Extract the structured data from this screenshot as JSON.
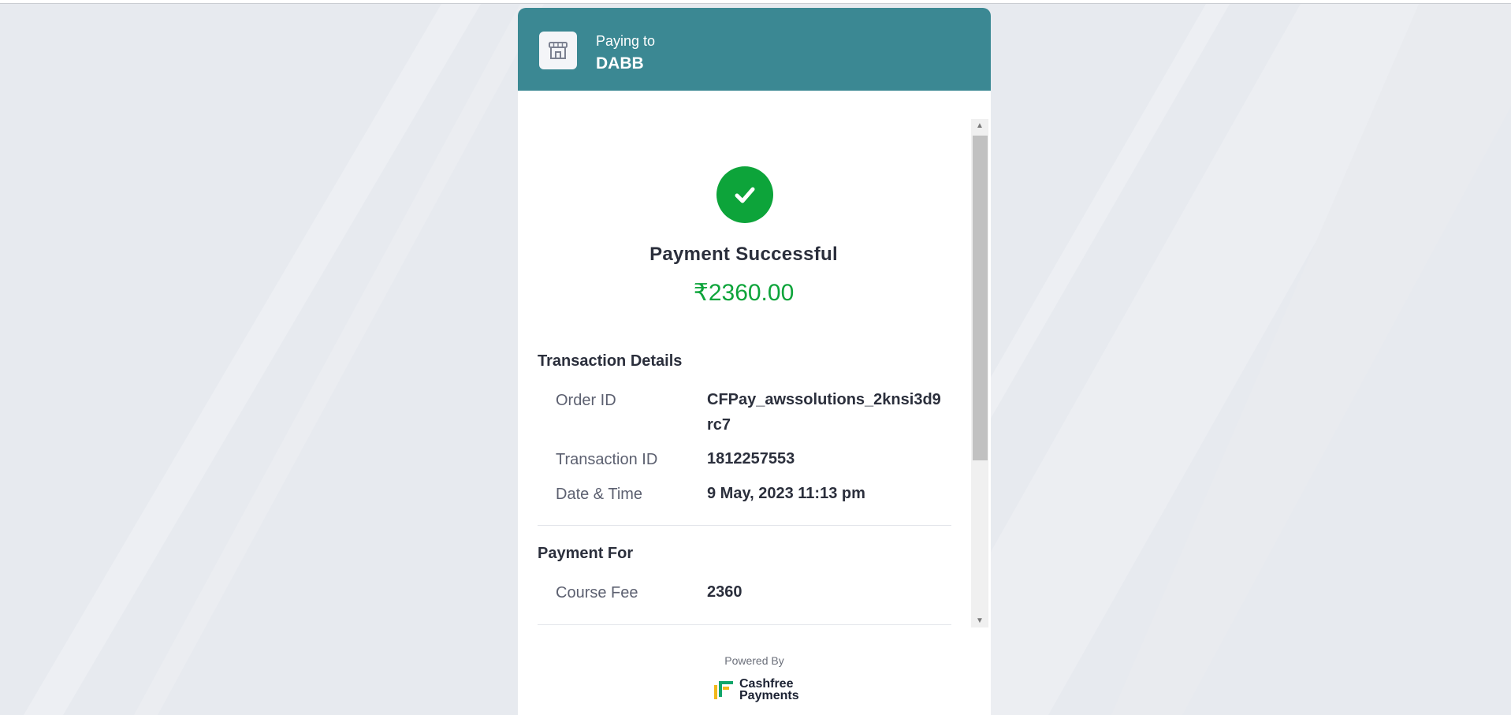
{
  "header": {
    "paying_to_label": "Paying to",
    "merchant_name": "DABB",
    "merchant_icon": "store-icon",
    "color": "#3b8893"
  },
  "status": {
    "icon": "check-icon",
    "title": "Payment Successful",
    "amount": "₹2360.00",
    "color": "#0da43a"
  },
  "transaction": {
    "title": "Transaction Details",
    "rows": [
      {
        "label": "Order ID",
        "value": "CFPay_awssolutions_2knsi3d9rc7"
      },
      {
        "label": "Transaction ID",
        "value": "1812257553"
      },
      {
        "label": "Date & Time",
        "value": "9 May, 2023 11:13 pm"
      }
    ]
  },
  "payment_for": {
    "title": "Payment For",
    "rows": [
      {
        "label": "Course Fee",
        "value": "2360"
      }
    ]
  },
  "footer": {
    "powered_by": "Powered By",
    "brand_line1": "Cashfree",
    "brand_line2": "Payments"
  }
}
